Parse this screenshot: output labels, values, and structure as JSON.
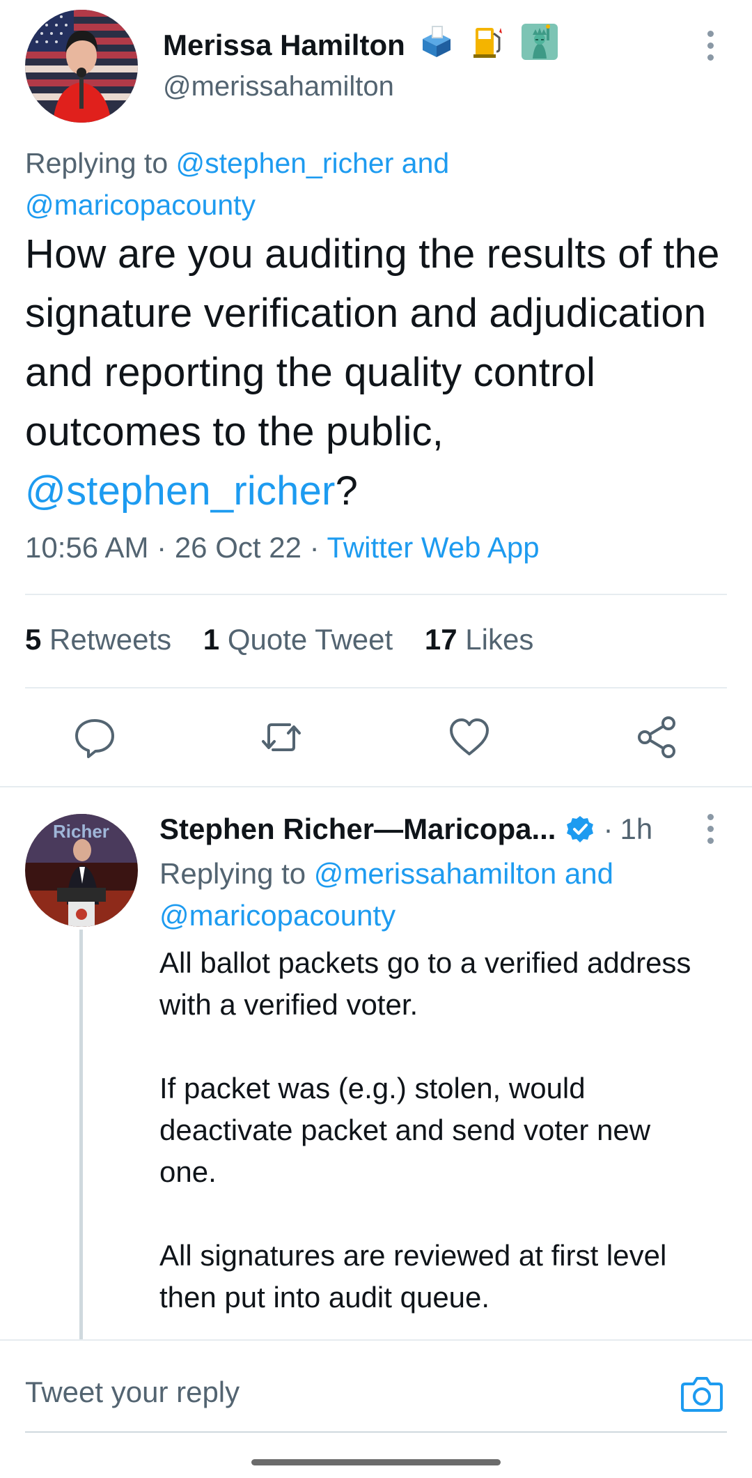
{
  "main_tweet": {
    "author_name": "Merissa Hamilton",
    "author_handle": "@merissahamilton",
    "name_emojis": [
      "ballot-box-icon",
      "fuel-pump-icon",
      "statue-of-liberty-icon"
    ],
    "replying_prefix": "Replying to",
    "replying_users": [
      "@stephen_richer",
      "@maricopacounty"
    ],
    "replying_conjunction": "and",
    "text_before_mention": "How are you auditing the results of the signature verification and adjudication and reporting the quality control outcomes to the public,",
    "text_mention": "@stephen_richer",
    "text_after_mention": "?",
    "time": "10:56 AM",
    "date": "26 Oct 22",
    "source": "Twitter Web App",
    "separator": "·"
  },
  "stats": {
    "retweets_count": "5",
    "retweets_label": "Retweets",
    "quotes_count": "1",
    "quotes_label": "Quote Tweet",
    "likes_count": "17",
    "likes_label": "Likes"
  },
  "actions": [
    "reply-icon",
    "retweet-icon",
    "like-icon",
    "share-icon"
  ],
  "reply_tweet": {
    "author_name": "Stephen Richer—Maricopa...",
    "verified": true,
    "separator": "·",
    "time_ago": "1h",
    "replying_prefix": "Replying to",
    "replying_users": [
      "@merissahamilton",
      "@maricopacounty"
    ],
    "replying_conjunction": "and",
    "avatar_overlay_text": "Richer",
    "paragraphs": [
      "All ballot packets go to a verified address with a verified voter.",
      "If packet was (e.g.) stolen, would deactivate packet and send voter new one.",
      "All signatures are reviewed at first level then put into audit queue."
    ]
  },
  "composer": {
    "placeholder": "Tweet your reply"
  },
  "colors": {
    "link": "#1d9bf0",
    "text": "#0f1419",
    "muted": "#536471",
    "divider": "#e6ecf0",
    "verified": "#1d9bf0"
  }
}
